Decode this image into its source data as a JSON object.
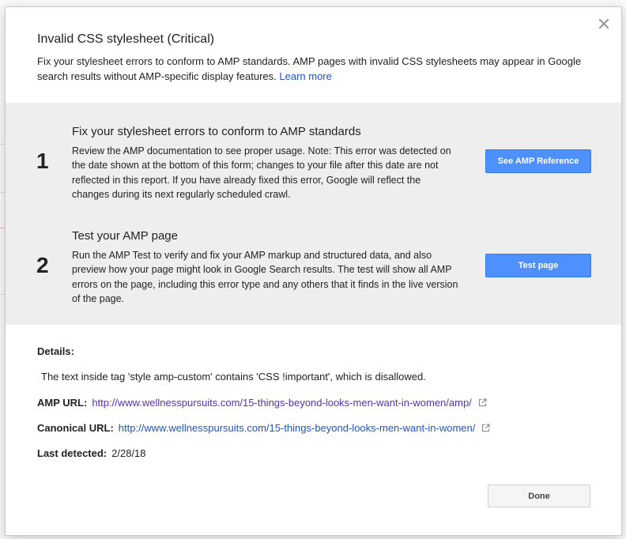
{
  "dialog": {
    "title": "Invalid CSS stylesheet (Critical)",
    "description": "Fix your stylesheet errors to conform to AMP standards. AMP pages with invalid CSS stylesheets may appear in Google search results without AMP-specific display features.",
    "learn_more": "Learn more"
  },
  "steps": [
    {
      "number": "1",
      "title": "Fix your stylesheet errors to conform to AMP standards",
      "body": "Review the AMP documentation to see proper usage. Note: This error was detected on the date shown at the bottom of this form; changes to your file after this date are not reflected in this report. If you have already fixed this error, Google will reflect the changes during its next regularly scheduled crawl.",
      "button": "See AMP Reference"
    },
    {
      "number": "2",
      "title": "Test your AMP page",
      "body": "Run the AMP Test to verify and fix your AMP markup and structured data, and also preview how your page might look in Google Search results. The test will show all AMP errors on the page, including this error type and any others that it finds in the live version of the page.",
      "button": "Test page"
    }
  ],
  "details": {
    "label": "Details:",
    "text": "The text inside tag 'style amp-custom' contains 'CSS !important', which is disallowed.",
    "amp_url_label": "AMP URL:",
    "amp_url": "http://www.wellnesspursuits.com/15-things-beyond-looks-men-want-in-women/amp/",
    "canonical_url_label": "Canonical URL:",
    "canonical_url": "http://www.wellnesspursuits.com/15-things-beyond-looks-men-want-in-women/",
    "last_detected_label": "Last detected:",
    "last_detected": "2/28/18"
  },
  "done_button": "Done",
  "icons": {
    "close": "close-icon",
    "external_link": "external-link-icon"
  },
  "colors": {
    "primary_button": "#4d90fe",
    "link": "#1a55c9",
    "visited_link": "#5a2fb0",
    "steps_background": "#eeeeee"
  }
}
